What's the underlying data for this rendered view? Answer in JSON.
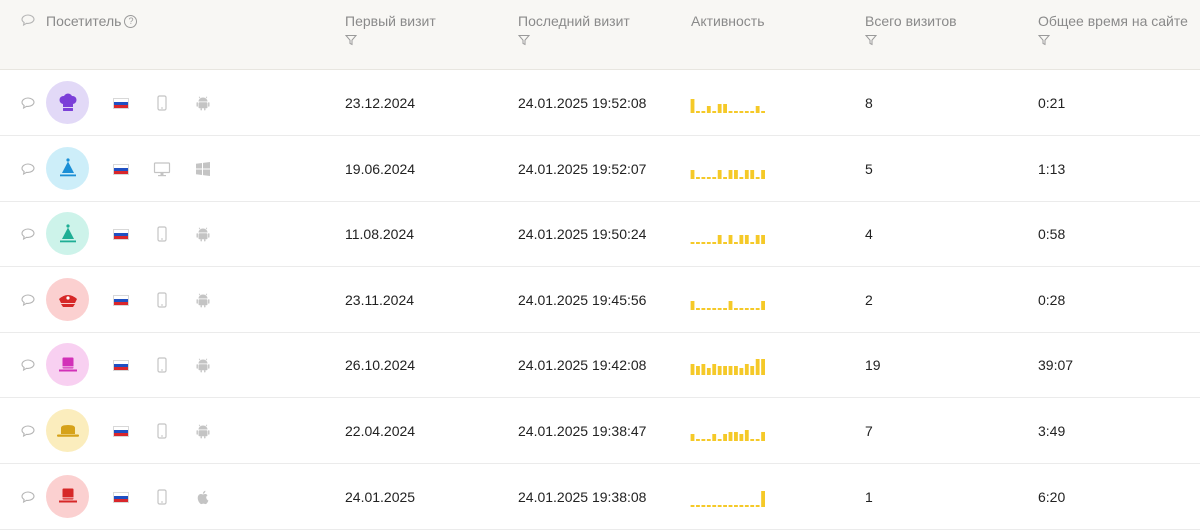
{
  "header": {
    "visitor": "Посетитель",
    "visitor_help": "?",
    "first_visit": "Первый визит",
    "last_visit": "Последний визит",
    "activity": "Активность",
    "total_visits": "Всего визитов",
    "total_time": "Общее время на сайте"
  },
  "colors": {
    "spark": "#f5c928",
    "header_bg": "#f8f7f4",
    "icon_gray": "#c4c4c4"
  },
  "rows": [
    {
      "avatar_icon": "chef-hat-icon",
      "avatar_bg": "#e2d9f7",
      "avatar_fg": "#7b3fd8",
      "country": "russia-flag-icon",
      "device": "smartphone-icon",
      "os": "android-icon",
      "first": "23.12.2024",
      "last": "24.01.2025 19:52:08",
      "visits": "8",
      "time": "0:21",
      "activity": [
        0.7,
        0.1,
        0.1,
        0.35,
        0.1,
        0.45,
        0.45,
        0.1,
        0.1,
        0.1,
        0.1,
        0.1,
        0.35,
        0.1
      ]
    },
    {
      "avatar_icon": "party-hat-icon",
      "avatar_bg": "#cdeef9",
      "avatar_fg": "#1b8fd6",
      "country": "russia-flag-icon",
      "device": "desktop-icon",
      "os": "windows-icon",
      "first": "19.06.2024",
      "last": "24.01.2025 19:52:07",
      "visits": "5",
      "time": "1:13",
      "activity": [
        0.45,
        0.1,
        0.1,
        0.1,
        0.1,
        0.45,
        0.1,
        0.45,
        0.45,
        0.1,
        0.45,
        0.45,
        0.1,
        0.45
      ]
    },
    {
      "avatar_icon": "party-hat-icon",
      "avatar_bg": "#cdf3ea",
      "avatar_fg": "#1fae95",
      "country": "russia-flag-icon",
      "device": "smartphone-icon",
      "os": "android-icon",
      "first": "11.08.2024",
      "last": "24.01.2025 19:50:24",
      "visits": "4",
      "time": "0:58",
      "activity": [
        0.1,
        0.1,
        0.1,
        0.1,
        0.1,
        0.45,
        0.1,
        0.45,
        0.1,
        0.45,
        0.45,
        0.1,
        0.45,
        0.45
      ]
    },
    {
      "avatar_icon": "captain-hat-icon",
      "avatar_bg": "#fbd0d0",
      "avatar_fg": "#d62828",
      "country": "russia-flag-icon",
      "device": "smartphone-icon",
      "os": "android-icon",
      "first": "23.11.2024",
      "last": "24.01.2025 19:45:56",
      "visits": "2",
      "time": "0:28",
      "activity": [
        0.45,
        0.1,
        0.1,
        0.1,
        0.1,
        0.1,
        0.1,
        0.45,
        0.1,
        0.1,
        0.1,
        0.1,
        0.1,
        0.45
      ]
    },
    {
      "avatar_icon": "top-hat-icon",
      "avatar_bg": "#f8d0f1",
      "avatar_fg": "#d231b8",
      "country": "russia-flag-icon",
      "device": "smartphone-icon",
      "os": "android-icon",
      "first": "26.10.2024",
      "last": "24.01.2025 19:42:08",
      "visits": "19",
      "time": "39:07",
      "activity": [
        0.55,
        0.45,
        0.55,
        0.35,
        0.55,
        0.45,
        0.45,
        0.45,
        0.45,
        0.35,
        0.55,
        0.45,
        0.8,
        0.8
      ]
    },
    {
      "avatar_icon": "fedora-hat-icon",
      "avatar_bg": "#fbedbd",
      "avatar_fg": "#d6a21a",
      "country": "russia-flag-icon",
      "device": "smartphone-icon",
      "os": "android-icon",
      "first": "22.04.2024",
      "last": "24.01.2025 19:38:47",
      "visits": "7",
      "time": "3:49",
      "activity": [
        0.35,
        0.1,
        0.1,
        0.1,
        0.35,
        0.1,
        0.35,
        0.45,
        0.45,
        0.35,
        0.55,
        0.1,
        0.1,
        0.45
      ]
    },
    {
      "avatar_icon": "top-hat-icon",
      "avatar_bg": "#fbd0d0",
      "avatar_fg": "#d62828",
      "country": "russia-flag-icon",
      "device": "smartphone-icon",
      "os": "apple-icon",
      "first": "24.01.2025",
      "last": "24.01.2025 19:38:08",
      "visits": "1",
      "time": "6:20",
      "activity": [
        0.1,
        0.1,
        0.1,
        0.1,
        0.1,
        0.1,
        0.1,
        0.1,
        0.1,
        0.1,
        0.1,
        0.1,
        0.1,
        0.8
      ]
    }
  ]
}
